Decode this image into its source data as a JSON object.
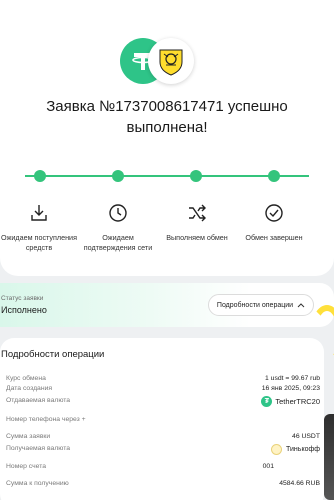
{
  "order": {
    "title": "Заявка №1737008617471 успешно выполнена!"
  },
  "steps": [
    {
      "label": "Ожидаем поступления средств",
      "icon": "download-icon"
    },
    {
      "label": "Ожидаем подтверждения сети",
      "icon": "clock-icon"
    },
    {
      "label": "Выполняем обмен",
      "icon": "shuffle-icon"
    },
    {
      "label": "Обмен завершен",
      "icon": "check-circle-icon"
    }
  ],
  "status": {
    "label": "Статус заявки",
    "value": "Исполнено",
    "details_button": "Подробности операции"
  },
  "details": {
    "title": "Подробности операции",
    "rate_label": "Курс обмена",
    "rate_value": "1 usdt = 99.67 rub",
    "created_label": "Дата создания",
    "created_value": "16 янв 2025, 09:23",
    "give_label": "Отдаваемая валюта",
    "give_value": "TetherTRC20",
    "phone_label": "Номер телефона через +",
    "amount_label": "Сумма заявки",
    "amount_value": "46 USDT",
    "receive_label": "Получаемая валюта",
    "receive_value": "Тинькофф",
    "account_label": "Номер счета",
    "account_value": "001",
    "to_receive_label": "Сумма к получению",
    "to_receive_value": "4584.66 RUB"
  },
  "colors": {
    "accent": "#34c47c",
    "tether": "#2ec488",
    "status_bg": "#d9f7ea"
  }
}
